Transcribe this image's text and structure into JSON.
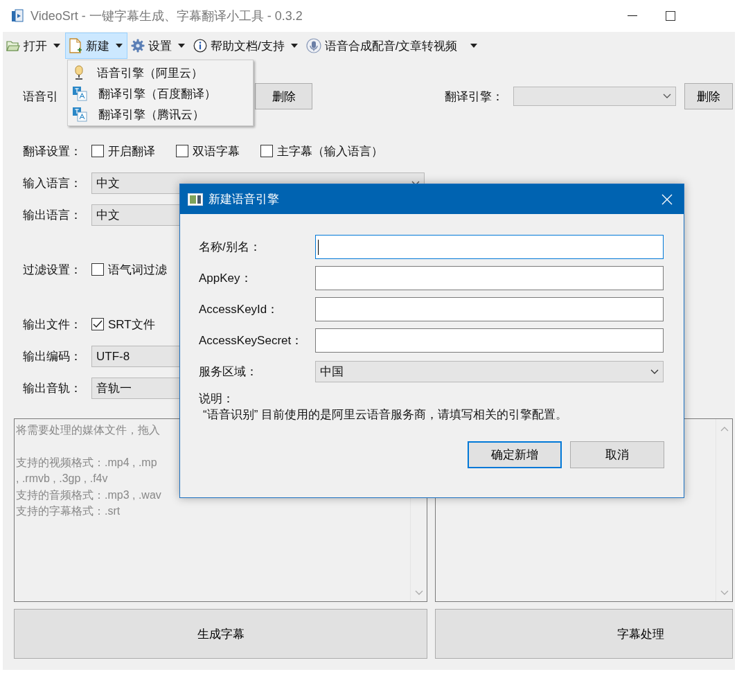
{
  "window": {
    "title": "VideoSrt - 一键字幕生成、字幕翻译小工具 - 0.3.2"
  },
  "menu_bar": [
    {
      "label": "打开",
      "kind": "folder",
      "selected": false
    },
    {
      "label": "新建",
      "kind": "new-file",
      "selected": true
    },
    {
      "label": "设置",
      "kind": "gear",
      "selected": false
    },
    {
      "label": "帮助文档/支持",
      "kind": "info",
      "selected": false
    },
    {
      "label": "语音合成配音/文章转视频",
      "kind": "voice",
      "selected": false
    }
  ],
  "new_menu": [
    {
      "label": "语音引擎（阿里云）",
      "kind": "speech"
    },
    {
      "label": "翻译引擎（百度翻译）",
      "kind": "translate"
    },
    {
      "label": "翻译引擎（腾讯云）",
      "kind": "translate"
    }
  ],
  "engines": {
    "speech_label": "语音引",
    "speech_delete": "删除",
    "translate_label": "翻译引擎：",
    "translate_delete": "删除"
  },
  "translate_settings": {
    "label": "翻译设置：",
    "options": [
      {
        "label": "开启翻译",
        "checked": false
      },
      {
        "label": "双语字幕",
        "checked": false
      },
      {
        "label": "主字幕（输入语言）",
        "checked": false
      }
    ]
  },
  "input_language": {
    "label": "输入语言：",
    "value": "中文"
  },
  "output_language": {
    "label": "输出语言：",
    "value": "中文"
  },
  "filter_settings": {
    "label": "过滤设置：",
    "options": [
      {
        "label": "语气词过滤",
        "checked": false
      }
    ]
  },
  "output_file": {
    "label": "输出文件：",
    "options": [
      {
        "label": "SRT文件",
        "checked": true
      }
    ]
  },
  "output_encoding": {
    "label": "输出编码：",
    "value": "UTF-8"
  },
  "output_track": {
    "label": "输出音轨：",
    "value": "音轨一"
  },
  "drop_area": {
    "hint": "将需要处理的媒体文件，拖入",
    "formats": [
      "支持的视频格式：.mp4 , .mp",
      ", .rmvb , .3gp , .f4v",
      "支持的音频格式：.mp3 , .wav",
      "支持的字幕格式：.srt"
    ]
  },
  "buttons": [
    "生成字幕",
    "字幕处理"
  ],
  "dialog": {
    "title": "新建语音引擎",
    "fields": [
      {
        "label": "名称/别名：",
        "kind": "text",
        "focused": true
      },
      {
        "label": "AppKey：",
        "kind": "text",
        "focused": false
      },
      {
        "label": "AccessKeyId：",
        "kind": "text",
        "focused": false
      },
      {
        "label": "AccessKeySecret：",
        "kind": "text",
        "focused": false
      },
      {
        "label": "服务区域：",
        "kind": "select",
        "value": "中国",
        "focused": false
      }
    ],
    "note_title": "说明：",
    "note": "“语音识别” 目前使用的是阿里云语音服务商，请填写相关的引擎配置。",
    "buttons": [
      {
        "label": "确定新增",
        "default": true
      },
      {
        "label": "取消",
        "default": false
      }
    ]
  }
}
